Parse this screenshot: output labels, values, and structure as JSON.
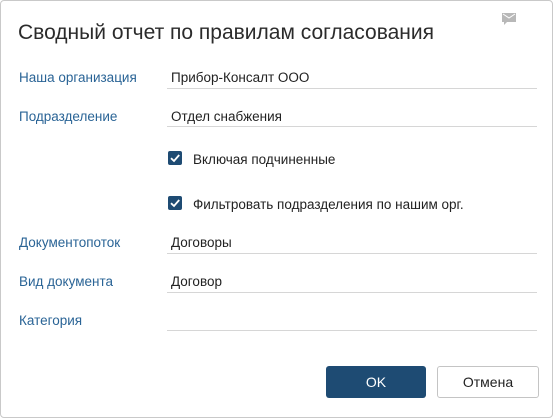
{
  "dialog": {
    "title": "Сводный отчет по правилам согласования",
    "title_icon": "message-icon"
  },
  "fields": {
    "organization": {
      "label": "Наша организация",
      "value": "Прибор-Консалт ООО"
    },
    "department": {
      "label": "Подразделение",
      "value": "Отдел снабжения"
    },
    "document_flow": {
      "label": "Документопоток",
      "value": "Договоры"
    },
    "document_type": {
      "label": "Вид документа",
      "value": "Договор"
    },
    "category": {
      "label": "Категория",
      "value": ""
    }
  },
  "checkboxes": {
    "include_subordinate": {
      "label": "Включая подчиненные",
      "checked": true
    },
    "filter_departments": {
      "label": "Фильтровать подразделения по нашим орг.",
      "checked": true
    }
  },
  "buttons": {
    "ok_label": "OK",
    "cancel_label": "Отмена"
  },
  "colors": {
    "accent": "#1e4b73",
    "label": "#2a6496",
    "divider": "#d6d6d6"
  }
}
